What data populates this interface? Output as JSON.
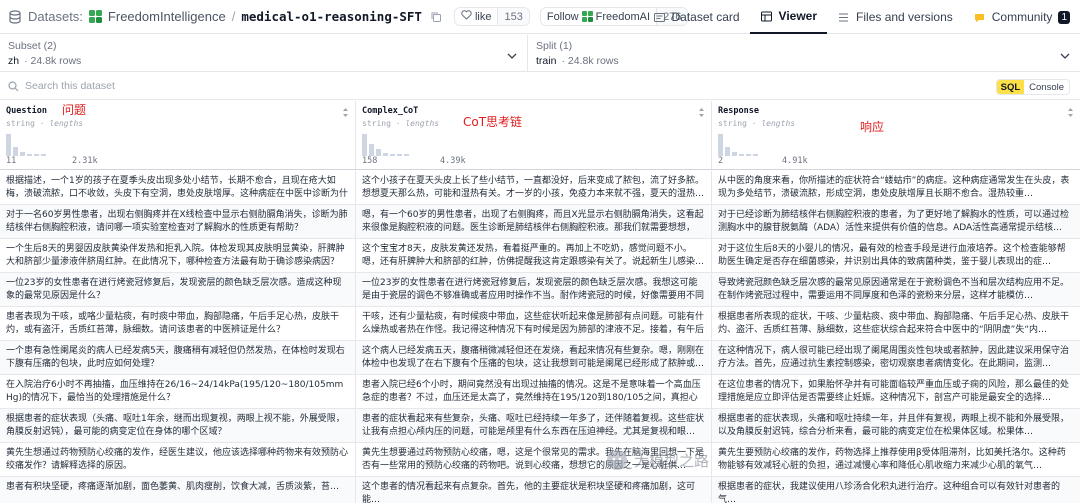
{
  "header": {
    "datasets_label": "Datasets:",
    "org": "FreedomIntelligence",
    "sep": "/",
    "dataset_name": "medical-o1-reasoning-SFT",
    "like_label": "like",
    "like_count": "153",
    "follow_label": "Follow",
    "follow_org": "FreedomAI",
    "follow_count": "276",
    "tabs": [
      {
        "label": "Dataset card"
      },
      {
        "label": "Viewer"
      },
      {
        "label": "Files and versions"
      },
      {
        "label": "Community"
      }
    ],
    "community_badge": "1"
  },
  "subset": {
    "label": "Subset (2)",
    "value": "zh",
    "rows": "· 24.8k rows"
  },
  "split": {
    "label": "Split (1)",
    "value": "train",
    "rows": "· 24.8k rows"
  },
  "search": {
    "placeholder": "Search this dataset",
    "sql_label": "SQL",
    "console_label": "Console"
  },
  "columns": [
    {
      "name": "Question",
      "type": "string",
      "stat": "lengths",
      "min": "11",
      "max": "2.31k",
      "annotation": "问题"
    },
    {
      "name": "Complex_CoT",
      "type": "string",
      "stat": "lengths",
      "min": "158",
      "max": "4.39k",
      "annotation": "CoT思考链"
    },
    {
      "name": "Response",
      "type": "string",
      "stat": "lengths",
      "min": "2",
      "max": "4.91k",
      "annotation": "响应"
    }
  ],
  "histograms": [
    [
      22,
      9,
      4,
      2,
      1,
      1
    ],
    [
      20,
      11,
      6,
      3,
      2,
      1,
      1
    ],
    [
      20,
      8,
      4,
      2,
      1,
      1
    ]
  ],
  "rows": [
    [
      "根据描述，一个1岁的孩子在夏季头皮出现多处小结节，长期不愈合，且现在疮大如梅，溃破流脓，口不收敛，头皮下有空洞，患处皮肤增厚。这种病症在中医中诊断为什么病？",
      "这个小孩子在夏天头皮上长了些小结节，一直都没好，后来变成了脓包，流了好多脓。想想夏天那么热，可能和湿热有关。才一岁的小孩，免疫力本来就不强，夏天的湿热…",
      "从中医的角度来看，你所描述的症状符合“蝼蛄疖”的病症。这种病症通常发生在头皮，表现为多处结节，溃破流脓，形成空洞，患处皮肤增厚且长期不愈合。湿热较重…"
    ],
    [
      "对于一名60岁男性患者，出现右侧胸疼并在X线检查中显示右侧肋膈角消失，诊断为肺结核伴右侧胸腔积液，请问哪一项实验室检查对了解胸水的性质更有帮助？",
      "嗯，有一个60岁的男性患者，出现了右侧胸疼，而且X光显示右侧肋膈角消失，这看起来很像是胸腔积液的问题。医生诊断是肺结核伴右侧胸腔积液。那我们就需要想想，如…",
      "对于已经诊断为肺结核伴右侧胸腔积液的患者，为了更好地了解胸水的性质，可以通过检测胸水中的腺苷脱氨酶（ADA）活性来提供有价值的信息。ADA活性高通常提示结核…"
    ],
    [
      "一个生后8天的男婴因皮肤黄染伴发热和拒乳入院。体检发现其皮肤明显黄染，肝脾肿大和脐部少量渗液伴脐周红肿。在此情况下，哪种检查方法最有助于确诊感染病因？",
      "这个宝宝才8天，皮肤发黄还发热，看着挺严重的。再加上不吃奶，感觉问题不小。嗯，还有肝脾肿大和脐部的红肿，仿佛提醒我这肯定跟感染有关了。说起新生儿感染…",
      "对于这位生后8天的小婴儿的情况，最有效的检查手段是进行血液培养。这个检查能够帮助医生确定是否存在细菌感染，并识别出具体的致病菌种类，鉴于婴儿表现出的症…"
    ],
    [
      "一位23岁的女性患者在进行烤瓷冠修复后，发现瓷层的颜色缺乏层次感。造成这种现象的最常见原因是什么？",
      "一位23岁的女性患者在进行烤瓷冠修复后，发现瓷层的颜色缺乏层次感。我想这可能是由于瓷层的调色不够准确或者应用时操作不当。耐作烤瓷冠的时候，好像需要用不同厚…",
      "导致烤瓷冠颜色缺乏层次感的最常见原因通常是在于瓷粉调色不当和层次结构应用不足。在制作烤瓷冠过程中，需要运用不同厚度和色泽的瓷粉来分层，这样才能模仿…"
    ],
    [
      "患者表现为干咳，或咯少量粘痰，有时痰中带血，胸部隐痛，午后手足心热，皮肤干灼，或有盗汗，舌质红苔薄，脉细数。请问该患者的中医辨证是什么？",
      "干咳，还有少量粘痰，有时候痰中带血，这些症状听起来像是肺部有点问题。可能有什么燥热或者热在作怪。我记得这种情况下有时候是因为肺部的津液不足。接着，有午后手…",
      "根据患者所表现的症状，干咳、少量粘痰、痰中带血、胸部隐痛、午后手足心热、皮肤干灼、盗汗、舌质红苔薄、脉细数，这些症状综合起来符合中医中的“阴阴虚”失“内…"
    ],
    [
      "一个患有急性阑尾炎的病人已经发病5天，腹痛稍有减轻但仍然发热，在体检时发现右下腹有压痛的包块，此时应如何处理？",
      "这个病人已经发病五天，腹痛稍微减轻但还在发烧，看起来情况有些复杂。嗯，刚刚在体检中也发现了在右下腹有个压痛的包块，这让我想到可能是阑尾已经形成了脓肿或…",
      "在这种情况下，病人很可能已经出现了阑尾周围炎性包块或者脓肿，因此建议采用保守治疗方法。首先，应通过抗生素控制感染，密切观察患者病情变化。在此期间，监测…"
    ],
    [
      "在入院治疗6小时不再抽搐，血压维持在26/16~24/14kPa(195/120~180/105mmHg)的情况下，最恰当的处理措施是什么？",
      "患者入院已经6个小时，期间竟然没有出现过抽搐的情况。这是不是意味着一个高血压急症的患者？不过，血压还是太高了，竟然维持在195/120到180/105之间，真担心会对身体…",
      "在这位患者的情况下，如果胎怀孕并有可能面临较严重血压或子痫的风险，那么最佳的处理措施是应立即评估是否需要终止妊娠。这种情况下，剖宫产可能是最安全的选择…"
    ],
    [
      "根据患者的症状表现（头痛、呕吐1年余，继而出现复视，两眼上视不能，外展受限，角膜反射迟钝），最可能的病变定位在身体的哪个区域？",
      "患者的症状看起来有些复杂，头痛、呕吐已经持续一年多了，还伴随着复视。这些症状让我有点担心颅内压的问题，可能是颅里有什么东西在压迫神经。尤其是复视和眼…",
      "根据患者的症状表现，头痛和呕吐持续一年，并且伴有复视，两眼上视不能和外展受限，以及角膜反射迟钝，综合分析来看，最可能的病变定位在松果体区域。松果体…"
    ],
    [
      "黄先生想通过药物预防心绞痛的发作，经医生建议，他应该选择哪种药物来有效预防心绞痛发作？请解释选择的原因。",
      "黄先生想要通过药物预防心绞痛，嗯，这是个很常见的需求。我先在脑海里回想一下是否有一些常用的预防心绞痛的药物吧。说到心绞痛，想想它的原因之一是心脏供…",
      "黄先生要预防心绞痛的发作，药物选择上推荐使用β受体阻滞剂，比如美托洛尔。这种药物能够有效减轻心脏的负担，通过减慢心率和降低心肌收缩力来减少心肌的氧气…"
    ],
    [
      "患者有积块坚硬，疼痛逐渐加剧，面色萎黄、肌肉瘦削，饮食大减，舌质淡紫，苔…",
      "这个患者的情况看起来有点复杂。首先，他的主要症状是积块坚硬和疼痛加剧，这可能…",
      "根据患者的症状，我建议使用八珍汤合化积丸进行治疗。这种组合可以有效针对患者的气…"
    ]
  ],
  "watermark": "大模型之路"
}
